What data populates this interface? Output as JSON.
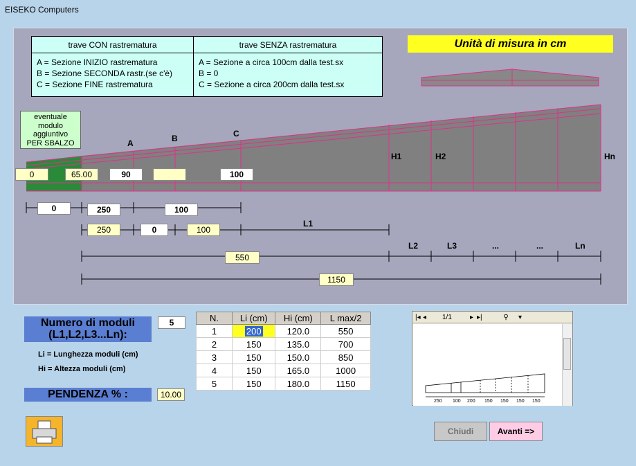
{
  "window": {
    "title": "EISEKO Computers"
  },
  "legend": {
    "col1_header": "trave CON rastrematura",
    "col2_header": "trave SENZA  rastrematura",
    "col1_rows": [
      "A = Sezione INIZIO rastrematura",
      "B = Sezione SECONDA rastr.(se c'è)",
      "C = Sezione FINE rastrematura"
    ],
    "col2_rows": [
      "A = Sezione a circa 100cm dalla test.sx",
      "B = 0",
      "C = Sezione a circa 200cm dalla test.sx"
    ]
  },
  "units_label": "Unità di misura in cm",
  "sbalzo_label": [
    "eventuale",
    "modulo",
    "aggiuntivo",
    "PER SBALZO"
  ],
  "section_labels": {
    "a": "A",
    "b": "B",
    "c": "C",
    "h1": "H1",
    "h2": "H2",
    "hn": "Hn"
  },
  "heights": {
    "sbalzo": "0",
    "start": "65.00",
    "a": "90",
    "b": "",
    "c": "100"
  },
  "dims_row1": {
    "sbalzo": "0",
    "a": "250",
    "bc": "100"
  },
  "dims_row2": {
    "a": "250",
    "b": "0",
    "c": "100",
    "l1": "L1"
  },
  "module_labels": {
    "l2": "L2",
    "l3": "L3",
    "dots1": "...",
    "dots2": "...",
    "ln": "Ln"
  },
  "total_550": "550",
  "total_1150": "1150",
  "num_moduli": {
    "title_line1": "Numero di moduli",
    "title_line2": "(L1,L2,L3...Ln):",
    "value": "5"
  },
  "notes": {
    "li": "Li = Lunghezza moduli (cm)",
    "hi": "Hi = Altezza moduli (cm)"
  },
  "pendenza": {
    "label": "PENDENZA % :",
    "value": "10.00"
  },
  "table": {
    "headers": [
      "N.",
      "Li (cm)",
      "Hi (cm)",
      "L max/2"
    ],
    "rows": [
      [
        "1",
        "200",
        "120.0",
        "550"
      ],
      [
        "2",
        "150",
        "135.0",
        "700"
      ],
      [
        "3",
        "150",
        "150.0",
        "850"
      ],
      [
        "4",
        "150",
        "165.0",
        "1000"
      ],
      [
        "5",
        "150",
        "180.0",
        "1150"
      ]
    ]
  },
  "preview": {
    "page": "1/1",
    "ticks": [
      "250",
      "100",
      "200",
      "150",
      "150",
      "150",
      "150"
    ]
  },
  "buttons": {
    "chiudi": "Chiudi",
    "avanti": "Avanti =>"
  }
}
